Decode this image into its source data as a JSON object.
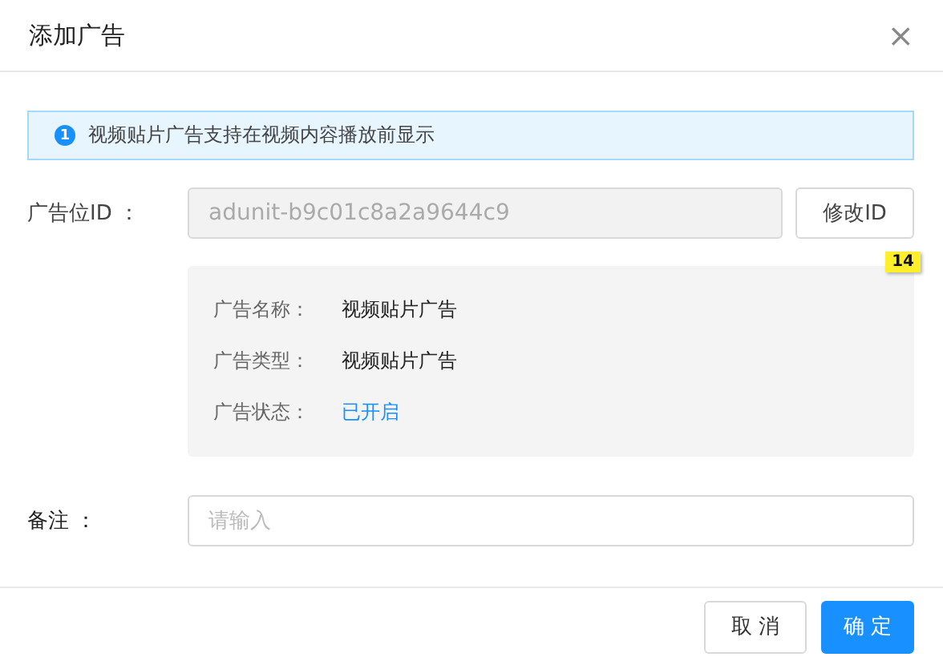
{
  "dialog": {
    "title": "添加广告",
    "close": "×"
  },
  "alert": {
    "icon": "1",
    "text": "视频贴片广告支持在视频内容播放前显示"
  },
  "ad_id": {
    "label": "广告位ID ：",
    "value": "adunit-b9c01c8a2a9644c9",
    "disabled": true,
    "button": "修改ID"
  },
  "badge": "14",
  "details": [
    {
      "label": "广告名称：",
      "value": "视频贴片广告",
      "kind": "text"
    },
    {
      "label": "广告类型：",
      "value": "视频贴片广告",
      "kind": "text"
    },
    {
      "label": "广告状态：",
      "value": "已开启",
      "kind": "status",
      "on": true
    }
  ],
  "remark": {
    "label": "备注 ：",
    "placeholder": "请输入"
  },
  "buttons": [
    {
      "label": "取 消",
      "kind": "default"
    },
    {
      "label": "确 定",
      "kind": "primary"
    }
  ]
}
